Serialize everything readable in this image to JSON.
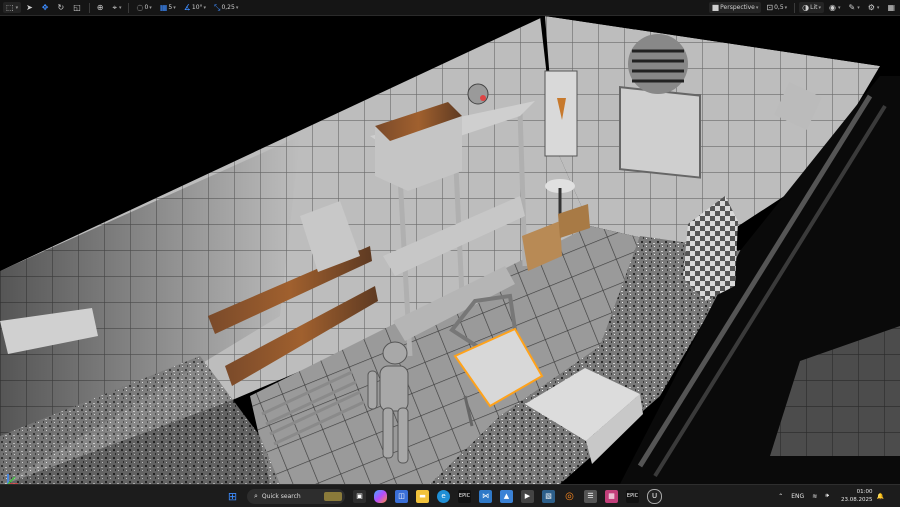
{
  "toolbar": {
    "snap_rotation": "0",
    "grid_size": "5",
    "rotation_snap": "10°",
    "scale_snap": "0,25",
    "view_mode": "Perspective",
    "camera_speed": "0,5",
    "lighting_mode": "Lit"
  },
  "taskbar": {
    "search_placeholder": "Quick search",
    "language": "ENG",
    "time": "01:00",
    "date": "23.08.2025"
  },
  "colors": {
    "accent": "#3d8cff",
    "selection_outline": "#ffa21a"
  }
}
